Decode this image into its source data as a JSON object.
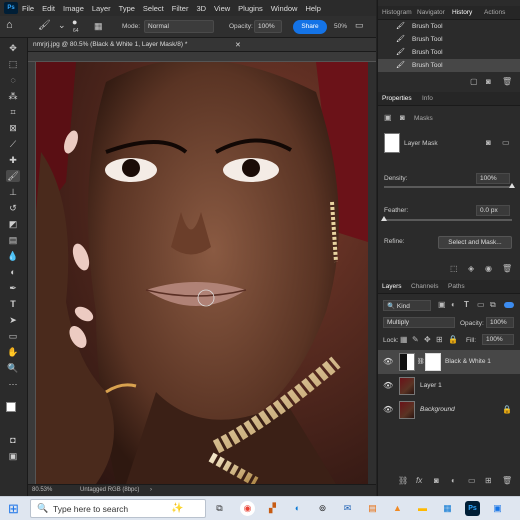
{
  "menu": {
    "app_logo": "Ps",
    "items": [
      "File",
      "Edit",
      "Image",
      "Layer",
      "Type",
      "Select",
      "Filter",
      "3D",
      "View",
      "Plugins",
      "Window",
      "Help"
    ]
  },
  "options": {
    "brush_size": "64",
    "mode_label": "Mode:",
    "mode_value": "Normal",
    "opacity_label": "Opacity:",
    "opacity_value": "100%",
    "share_label": "Share",
    "zoom_value": "50%"
  },
  "document": {
    "tab_title": "nmrjrj.jpg @ 80.5% (Black & White 1, Layer Mask/8) *",
    "status_zoom": "80.53%",
    "status_info": "Untagged RGB (8bpc)"
  },
  "history_panel": {
    "tabs": [
      "Histogram",
      "Navigator",
      "History",
      "Actions"
    ],
    "active_tab": "History",
    "items": [
      "Brush Tool",
      "Brush Tool",
      "Brush Tool",
      "Brush Tool"
    ]
  },
  "properties_panel": {
    "tabs": [
      "Properties",
      "Info"
    ],
    "section": "Masks",
    "mask_name": "Layer Mask",
    "density_label": "Density:",
    "density_value": "100%",
    "feather_label": "Feather:",
    "feather_value": "0.0 px",
    "refine_label": "Refine:",
    "select_mask_label": "Select and Mask...",
    "density_level": 1.0,
    "feather_level": 0.0
  },
  "layers_panel": {
    "tabs": [
      "Layers",
      "Channels",
      "Paths"
    ],
    "filter_value": "Kind",
    "blend_mode": "Multiply",
    "opacity_label": "Opacity:",
    "opacity_value": "100%",
    "lock_label": "Lock:",
    "fill_label": "Fill:",
    "fill_value": "100%",
    "layers": [
      {
        "name": "Black & White 1",
        "selected": true
      },
      {
        "name": "Layer 1",
        "selected": false
      },
      {
        "name": "Background",
        "selected": false
      }
    ]
  },
  "taskbar": {
    "search_placeholder": "Type here to search"
  },
  "colors": {
    "accent": "#1473e6",
    "panel_bg": "#2b2b2b",
    "selection": "#474747"
  }
}
